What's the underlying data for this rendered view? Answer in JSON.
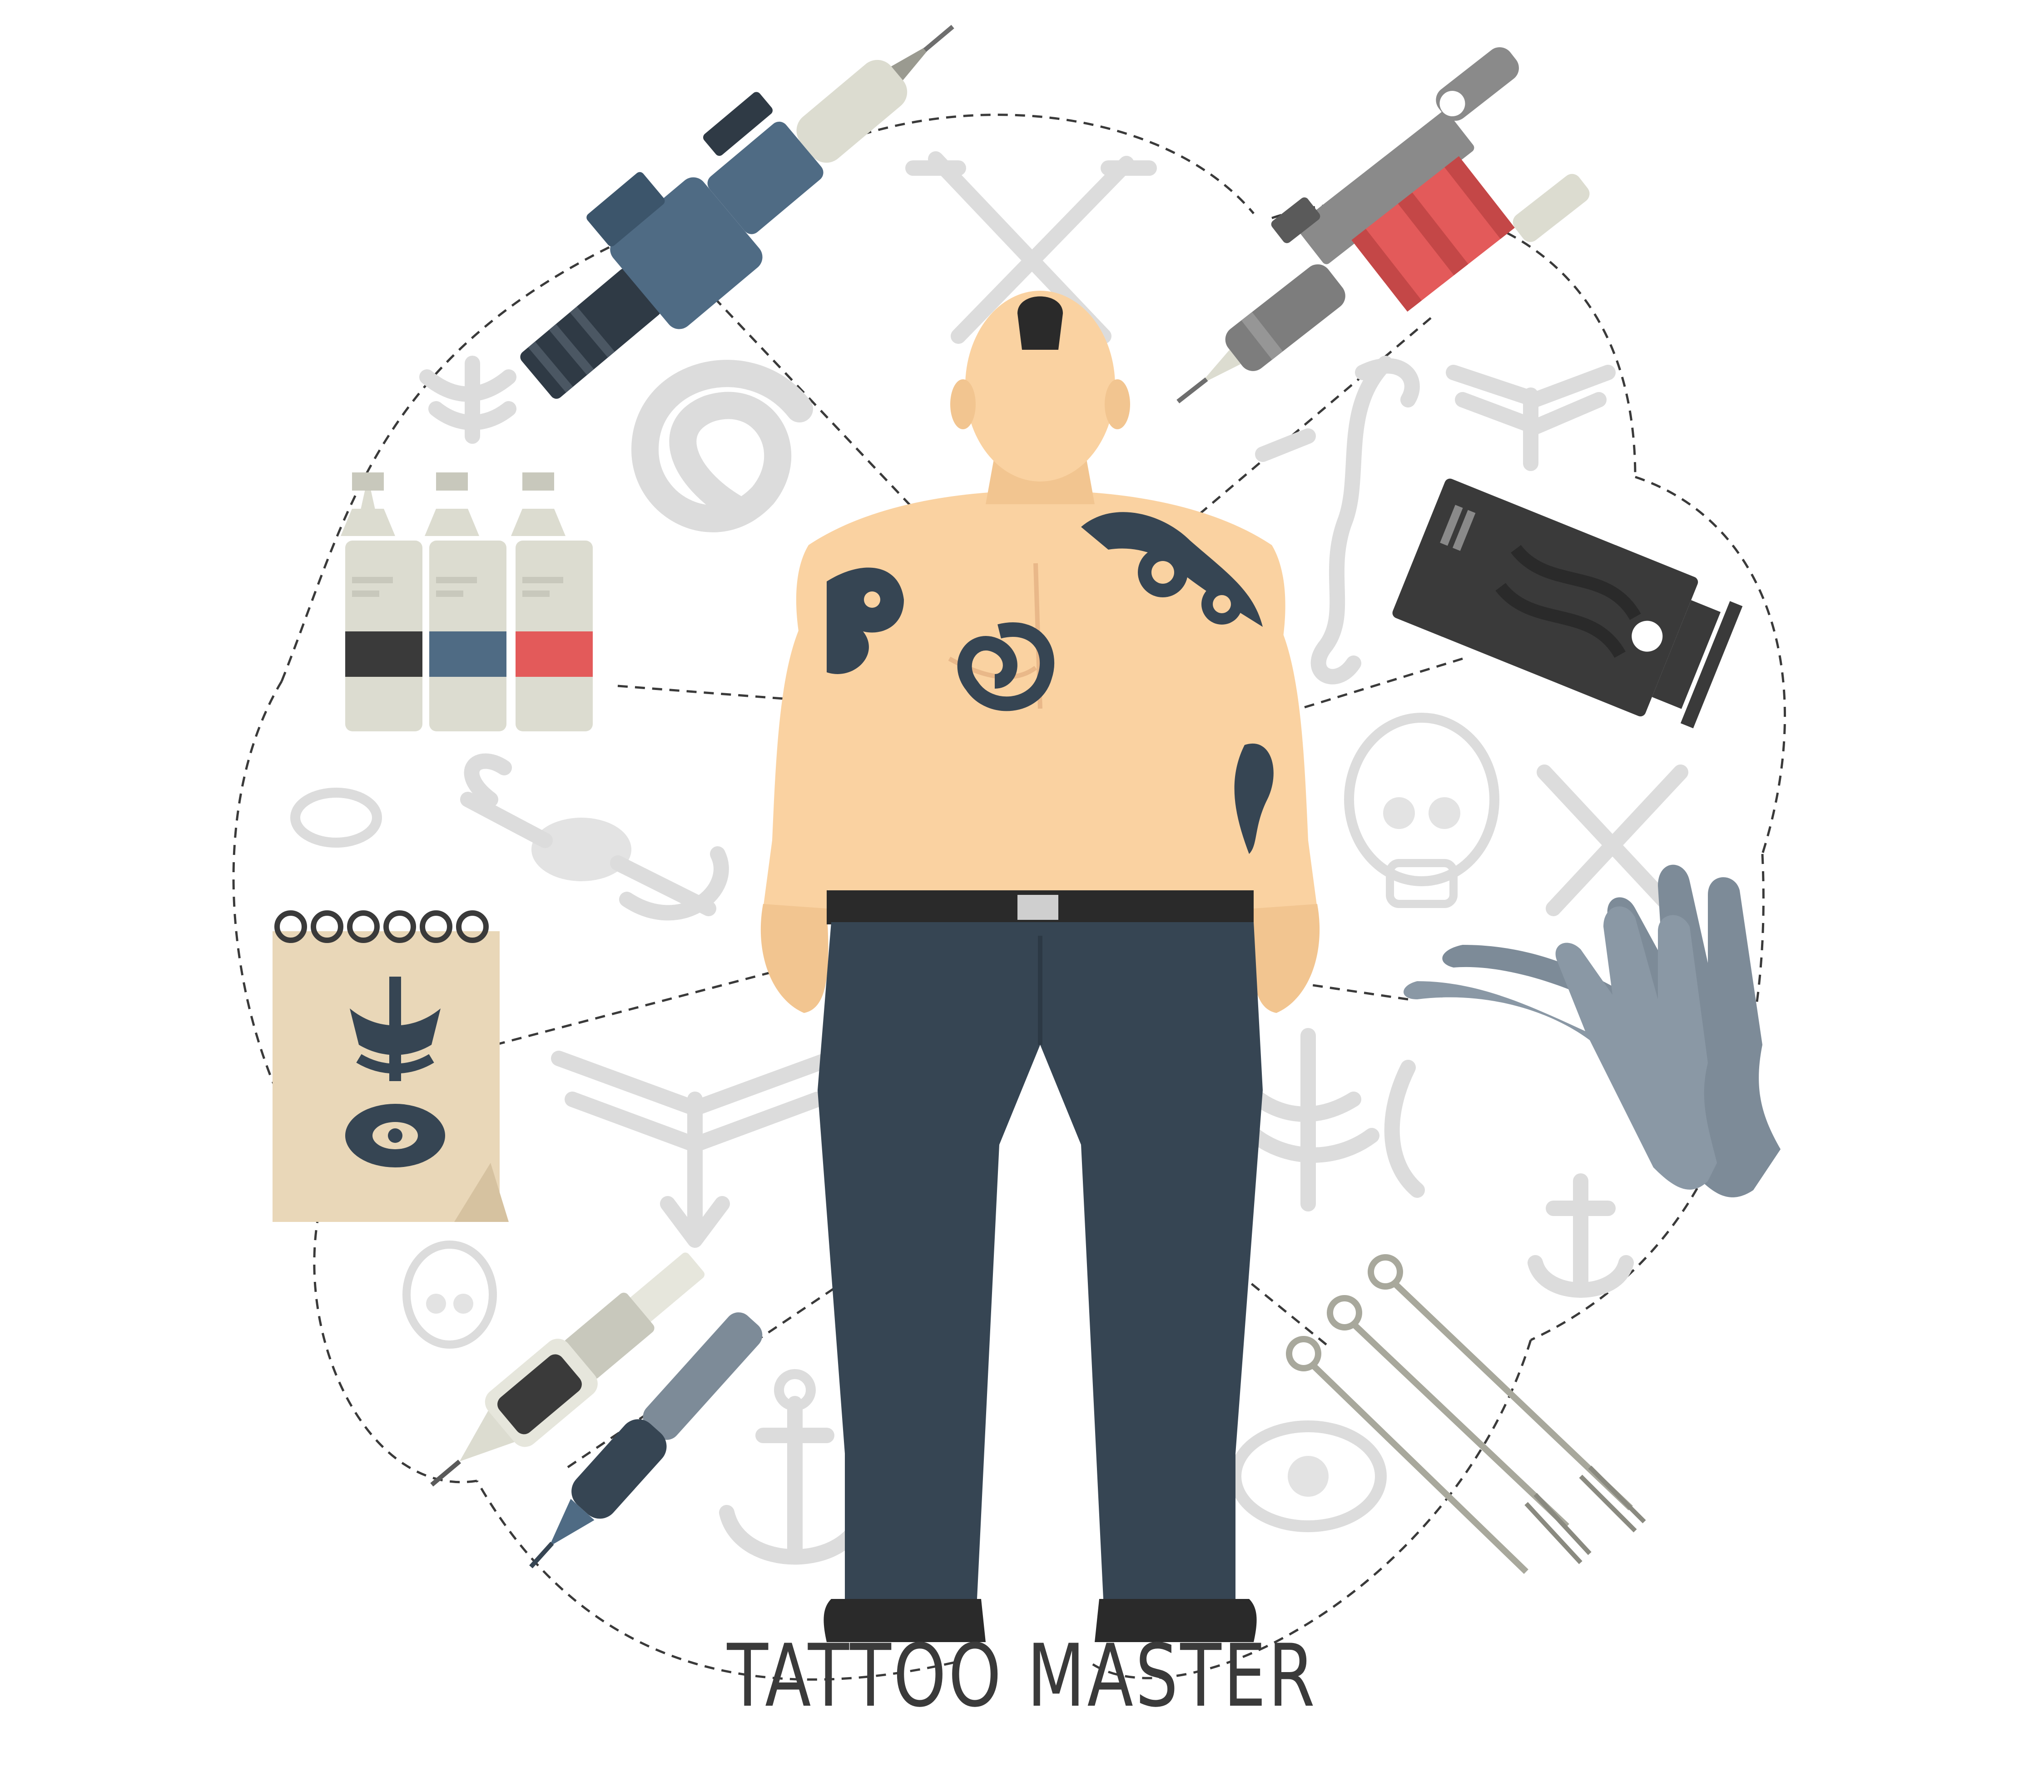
{
  "caption": "TATTOO MASTER",
  "colors": {
    "background": "#ffffff",
    "skin": "#fad2a1",
    "pants": "#364553",
    "tattoo_ink": "#364553",
    "ink_red": "#e35a5a",
    "ink_blue": "#4f6b84",
    "ink_black": "#3a3a3a",
    "glove": "#8a98a5",
    "paper": "#e9d7b8",
    "faint_decor": "#e0e0e0",
    "text": "#3a3a3a"
  },
  "icons": [
    "rotary-tattoo-machine-icon",
    "coil-tattoo-machine-icon",
    "ink-bottles-icon",
    "cream-tube-icon",
    "sketchbook-icon",
    "gloves-icon",
    "cartridge-needle-icon",
    "tattoo-pen-icon",
    "tattoo-needles-icon"
  ]
}
